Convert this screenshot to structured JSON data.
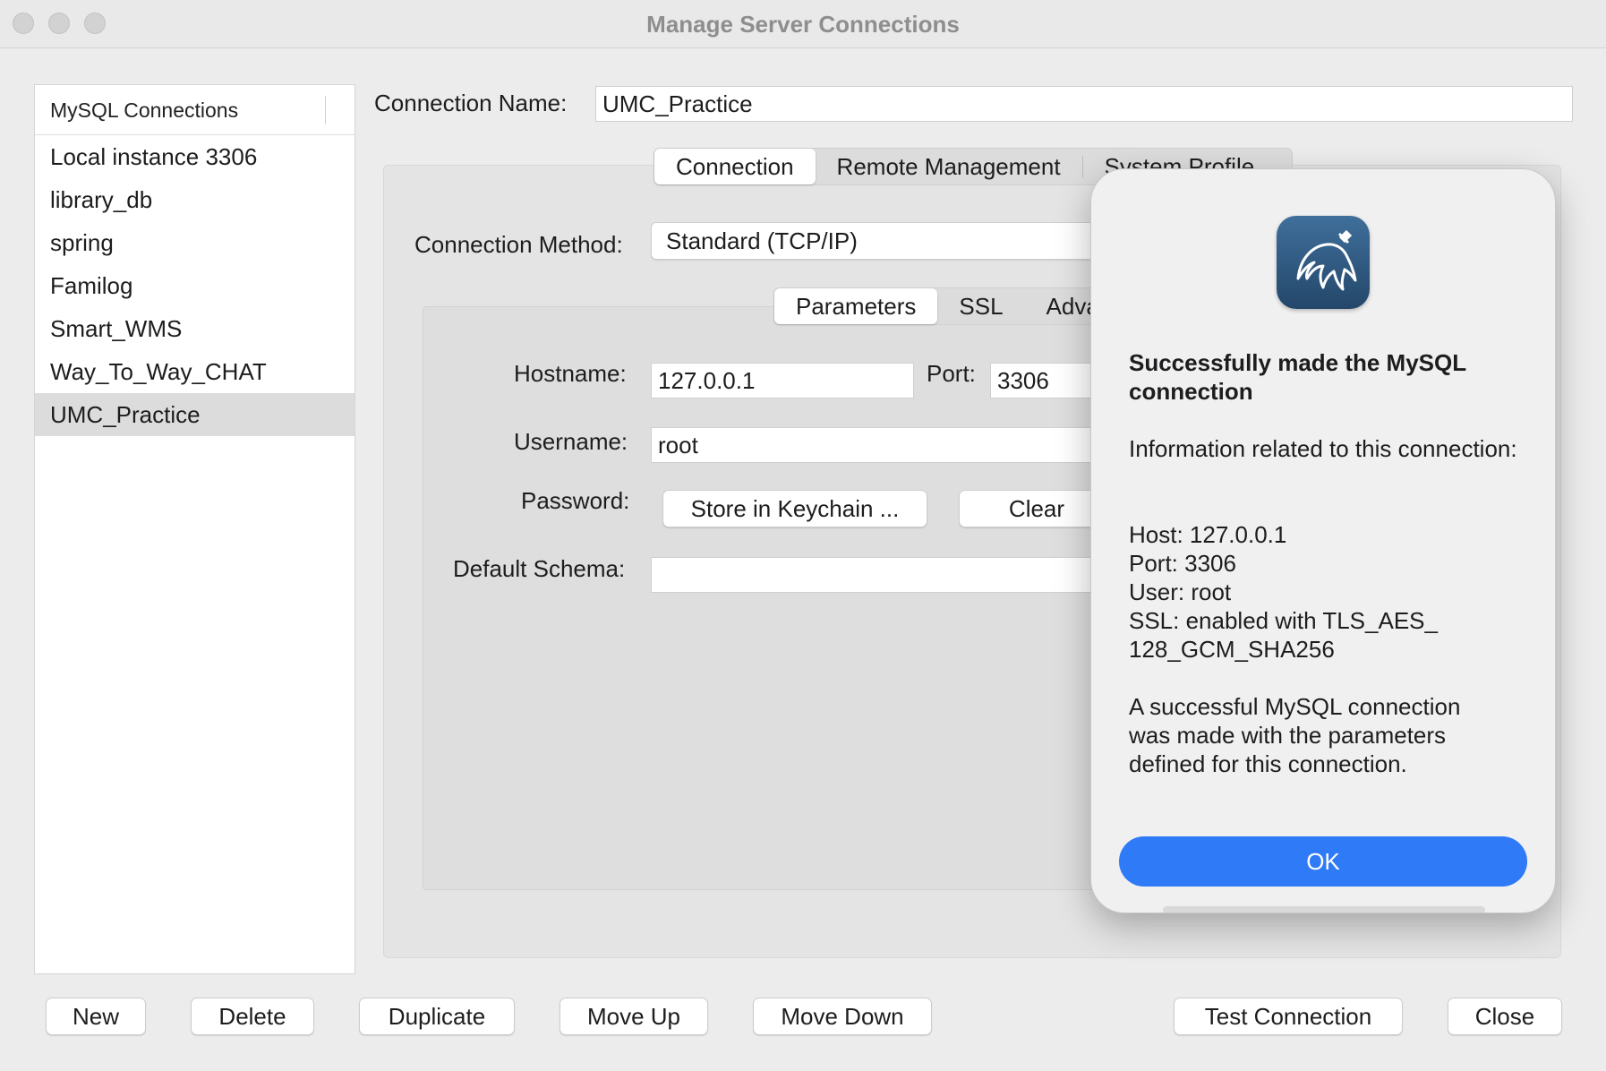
{
  "window": {
    "title": "Manage Server Connections"
  },
  "sidebar": {
    "header": "MySQL Connections",
    "items": [
      {
        "label": "Local instance 3306"
      },
      {
        "label": "library_db"
      },
      {
        "label": "spring"
      },
      {
        "label": "Familog"
      },
      {
        "label": "Smart_WMS"
      },
      {
        "label": "Way_To_Way_CHAT"
      },
      {
        "label": "UMC_Practice"
      }
    ],
    "selected": "UMC_Practice"
  },
  "form": {
    "connection_name_label": "Connection Name:",
    "connection_name_value": "UMC_Practice",
    "tabs": [
      "Connection",
      "Remote Management",
      "System Profile"
    ],
    "active_tab": "Connection",
    "connection_method_label": "Connection Method:",
    "connection_method_value": "Standard (TCP/IP)",
    "subtabs": [
      "Parameters",
      "SSL",
      "Adva"
    ],
    "active_subtab": "Parameters",
    "hostname_label": "Hostname:",
    "hostname_value": "127.0.0.1",
    "port_label": "Port:",
    "port_value": "3306",
    "username_label": "Username:",
    "username_value": "root",
    "password_label": "Password:",
    "store_keychain_label": "Store in Keychain ...",
    "clear_label": "Clear",
    "default_schema_label": "Default Schema:",
    "default_schema_value": ""
  },
  "footer": {
    "new": "New",
    "delete": "Delete",
    "duplicate": "Duplicate",
    "move_up": "Move Up",
    "move_down": "Move Down",
    "test_connection": "Test Connection",
    "close": "Close"
  },
  "dialog": {
    "icon": "mysql-dolphin-icon",
    "title": "Successfully made the MySQL connection",
    "intro": "Information related to this connection:",
    "host": "Host: 127.0.0.1",
    "port": "Port: 3306",
    "user": "User: root",
    "ssl": "SSL: enabled with TLS_AES_ 128_GCM_SHA256",
    "message": "A successful MySQL connection was made with the parameters defined for this connection.",
    "ok_label": "OK"
  },
  "colors": {
    "accent": "#2f7af6",
    "icon_bg": "#2d5379"
  }
}
